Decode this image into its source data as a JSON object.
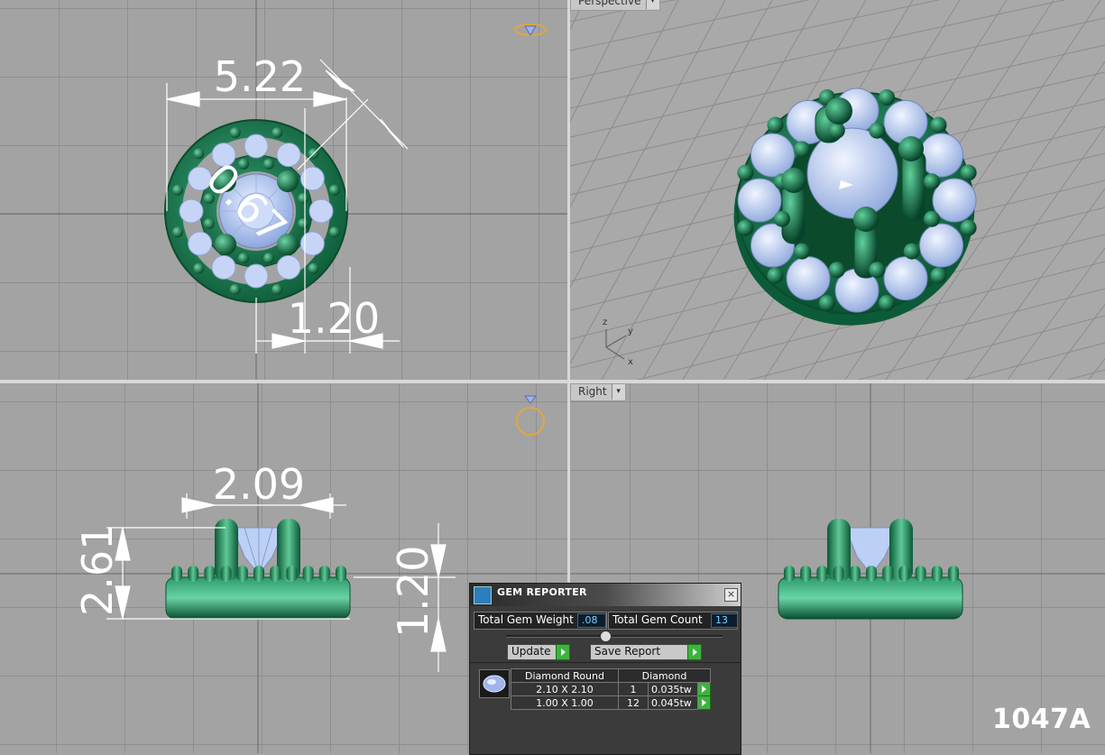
{
  "viewports": {
    "perspective_label": "Perspective",
    "right_label": "Right"
  },
  "dimensions": {
    "top_width": "5.22",
    "top_prong": "0.67",
    "top_band": "1.20",
    "front_width": "2.09",
    "front_height": "2.61",
    "front_band": "1.20"
  },
  "axis": {
    "x": "x",
    "y": "y",
    "z": "z"
  },
  "gem_reporter": {
    "title": "GEM REPORTER",
    "close": "×",
    "total_weight_label": "Total Gem Weight",
    "total_weight_value": ".08",
    "total_count_label": "Total Gem Count",
    "total_count_value": "13",
    "update_label": "Update",
    "save_label": "Save Report",
    "table_headers": [
      "Diamond Round",
      "Diamond"
    ],
    "rows": [
      {
        "size": "2.10 X 2.10",
        "count": "1",
        "weight": "0.035tw"
      },
      {
        "size": "1.00 X 1.00",
        "count": "12",
        "weight": "0.045tw"
      }
    ]
  },
  "colors": {
    "metal": "#1e7a4f",
    "gem": "#b3c8f0",
    "background": "#a3a3a3"
  },
  "model_id": "1047A"
}
